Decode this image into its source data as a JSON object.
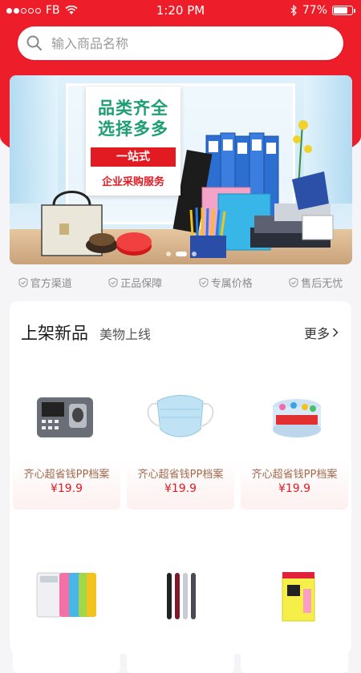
{
  "status_bar": {
    "carrier": "FB",
    "time": "1:20 PM",
    "battery": "77%",
    "battery_level": 0.77
  },
  "search": {
    "placeholder": "输入商品名称"
  },
  "banner": {
    "title_line1": "品类齐全",
    "title_line2": "选择多多",
    "badge": "一站式",
    "subtitle": "企业采购服务",
    "active_slide": 1,
    "slide_count": 3
  },
  "guarantees": [
    "官方渠道",
    "正品保障",
    "专属价格",
    "售后无忧"
  ],
  "section": {
    "title": "上架新品",
    "subtitle": "美物上线",
    "more": "更多"
  },
  "products": [
    {
      "name": "齐心超省钱PP档案",
      "price": "¥19.9",
      "icon": "fingerprint-machine-icon"
    },
    {
      "name": "齐心超省钱PP档案",
      "price": "¥19.9",
      "icon": "face-mask-icon"
    },
    {
      "name": "齐心超省钱PP档案",
      "price": "¥19.9",
      "icon": "binder-clips-icon"
    },
    {
      "name": "",
      "price": "",
      "icon": "calculator-icon"
    },
    {
      "name": "",
      "price": "",
      "icon": "pens-icon"
    },
    {
      "name": "",
      "price": "",
      "icon": "sticky-notes-icon"
    }
  ],
  "colors": {
    "brand_red": "#ee1d2a",
    "price_red": "#e21b23",
    "name_brown": "#a0694c"
  }
}
